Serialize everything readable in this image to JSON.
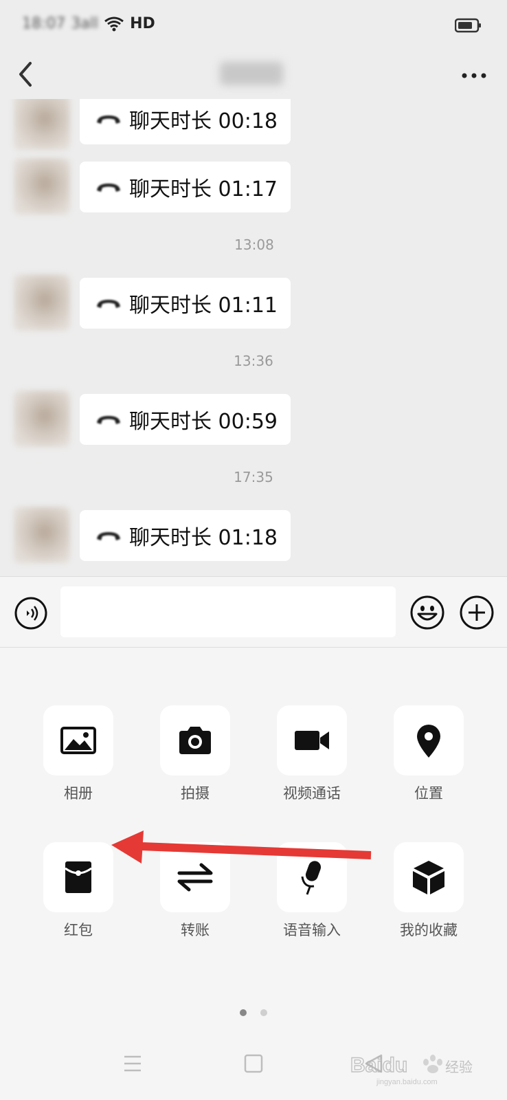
{
  "status_bar": {
    "time": "18:07",
    "signal": "3all",
    "network": "HD"
  },
  "nav": {
    "title": ""
  },
  "chat": {
    "messages": [
      {
        "text": "聊天时长 00:18"
      },
      {
        "text": "聊天时长 01:17"
      },
      {
        "timestamp": "13:08"
      },
      {
        "text": "聊天时长 01:11"
      },
      {
        "timestamp": "13:36"
      },
      {
        "text": "聊天时长 00:59"
      },
      {
        "timestamp": "17:35"
      },
      {
        "text": "聊天时长 01:18"
      }
    ]
  },
  "input": {
    "value": "",
    "placeholder": ""
  },
  "panel": {
    "items": [
      {
        "label": "相册",
        "icon": "photo-album-icon"
      },
      {
        "label": "拍摄",
        "icon": "camera-icon"
      },
      {
        "label": "视频通话",
        "icon": "video-call-icon"
      },
      {
        "label": "位置",
        "icon": "location-pin-icon"
      },
      {
        "label": "红包",
        "icon": "red-packet-icon"
      },
      {
        "label": "转账",
        "icon": "transfer-icon"
      },
      {
        "label": "语音输入",
        "icon": "microphone-icon"
      },
      {
        "label": "我的收藏",
        "icon": "favorites-box-icon"
      }
    ],
    "page_indicator": {
      "current": 1,
      "total": 2
    }
  },
  "annotation": {
    "arrow_color": "#e53935"
  },
  "watermark": {
    "brand": "Baidu",
    "suffix": "经验",
    "domain": "jingyan.baidu.com"
  },
  "colors": {
    "background": "#ededed",
    "panel": "#f5f5f5",
    "bubble": "#ffffff",
    "icon": "#111111",
    "label": "#555555",
    "timestamp": "#9a9a9a",
    "dot_active": "#888888",
    "dot_inactive": "#cfcfcf"
  }
}
